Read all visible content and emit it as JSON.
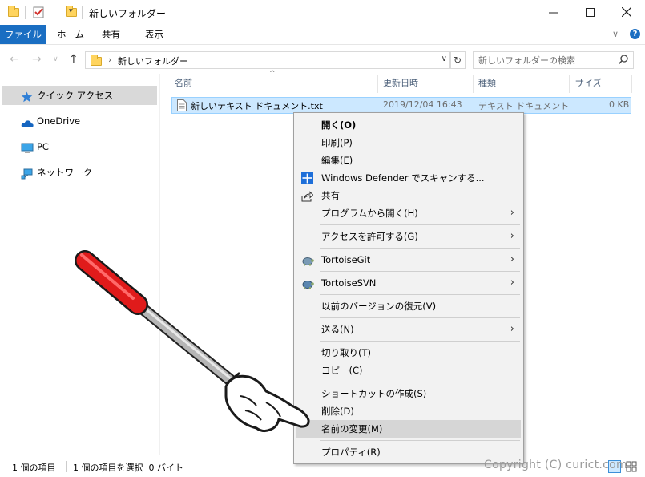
{
  "window": {
    "title": "新しいフォルダー",
    "minimize_icon": "minimize-icon",
    "maximize_icon": "maximize-icon",
    "close_icon": "close-icon"
  },
  "ribbon": {
    "tabs": [
      "ファイル",
      "ホーム",
      "共有",
      "表示"
    ],
    "active_color": "#1a6ec2"
  },
  "address": {
    "path": "新しいフォルダー",
    "search_placeholder": "新しいフォルダーの検索"
  },
  "nav_pane": {
    "items": [
      {
        "label": "クイック アクセス",
        "icon": "star-icon",
        "selected": true
      },
      {
        "label": "OneDrive",
        "icon": "cloud-icon"
      },
      {
        "label": "PC",
        "icon": "monitor-icon"
      },
      {
        "label": "ネットワーク",
        "icon": "network-icon"
      }
    ]
  },
  "file_list": {
    "columns": [
      "名前",
      "更新日時",
      "種類",
      "サイズ"
    ],
    "rows": [
      {
        "name": "新しいテキスト ドキュメント.txt",
        "modified": "2019/12/04 16:43",
        "type": "テキスト ドキュメント",
        "size": "0 KB",
        "selected": true
      }
    ]
  },
  "status": {
    "item_count": "1 個の項目",
    "selection": "1 個の項目を選択  0 バイト"
  },
  "context_menu": {
    "items": [
      {
        "label": "開く(O)",
        "bold": true
      },
      {
        "label": "印刷(P)"
      },
      {
        "label": "編集(E)"
      },
      {
        "label": "Windows Defender でスキャンする...",
        "icon": "defender-icon"
      },
      {
        "label": "共有",
        "icon": "share-icon"
      },
      {
        "label": "プログラムから開く(H)",
        "submenu": true
      },
      {
        "label": "アクセスを許可する(G)",
        "submenu": true
      },
      {
        "label": "TortoiseGit",
        "icon": "tortoisegit-icon",
        "submenu": true
      },
      {
        "label": "TortoiseSVN",
        "icon": "tortoisesvn-icon",
        "submenu": true
      },
      {
        "label": "以前のバージョンの復元(V)"
      },
      {
        "label": "送る(N)",
        "submenu": true
      },
      {
        "label": "切り取り(T)"
      },
      {
        "label": "コピー(C)"
      },
      {
        "label": "ショートカットの作成(S)"
      },
      {
        "label": "削除(D)"
      },
      {
        "label": "名前の変更(M)",
        "highlighted": true
      },
      {
        "label": "プロパティ(R)"
      }
    ]
  },
  "watermark": "Copyright (C) curict.com",
  "pointer_icon": "pointing-hand-icon"
}
